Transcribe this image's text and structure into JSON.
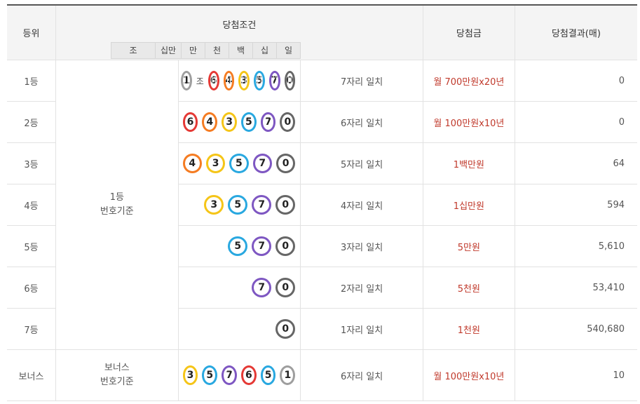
{
  "header": {
    "rank": "등위",
    "condition": "당첨조건",
    "prize": "당첨금",
    "result": "당첨결과(매)",
    "digits": [
      "조",
      "십만",
      "만",
      "천",
      "백",
      "십",
      "일"
    ]
  },
  "jo_label": "조",
  "basis_main": "1등\n번호기준",
  "basis_bonus": "보너스\n번호기준",
  "colors": {
    "1": "#9e9e9e",
    "6": "#e53935",
    "4": "#f57c22",
    "3": "#f5c518",
    "5": "#29a8e0",
    "7": "#7e57c2",
    "0": "#666666",
    "prize_text": "#c0392b"
  },
  "rows": [
    {
      "rank": "1등",
      "jo": "1",
      "balls": [
        "6",
        "4",
        "3",
        "5",
        "7",
        "0"
      ],
      "match": "7자리 일치",
      "prize": "월 700만원x20년",
      "count": "0"
    },
    {
      "rank": "2등",
      "balls": [
        "6",
        "4",
        "3",
        "5",
        "7",
        "0"
      ],
      "match": "6자리 일치",
      "prize": "월 100만원x10년",
      "count": "0"
    },
    {
      "rank": "3등",
      "balls": [
        "4",
        "3",
        "5",
        "7",
        "0"
      ],
      "match": "5자리 일치",
      "prize": "1백만원",
      "count": "64"
    },
    {
      "rank": "4등",
      "balls": [
        "3",
        "5",
        "7",
        "0"
      ],
      "match": "4자리 일치",
      "prize": "1십만원",
      "count": "594"
    },
    {
      "rank": "5등",
      "balls": [
        "5",
        "7",
        "0"
      ],
      "match": "3자리 일치",
      "prize": "5만원",
      "count": "5,610"
    },
    {
      "rank": "6등",
      "balls": [
        "7",
        "0"
      ],
      "match": "2자리 일치",
      "prize": "5천원",
      "count": "53,410"
    },
    {
      "rank": "7등",
      "balls": [
        "0"
      ],
      "match": "1자리 일치",
      "prize": "1천원",
      "count": "540,680"
    }
  ],
  "bonus": {
    "rank": "보너스",
    "balls": [
      "3",
      "5",
      "7",
      "6",
      "5",
      "1"
    ],
    "match": "6자리 일치",
    "prize": "월 100만원x10년",
    "count": "10"
  }
}
